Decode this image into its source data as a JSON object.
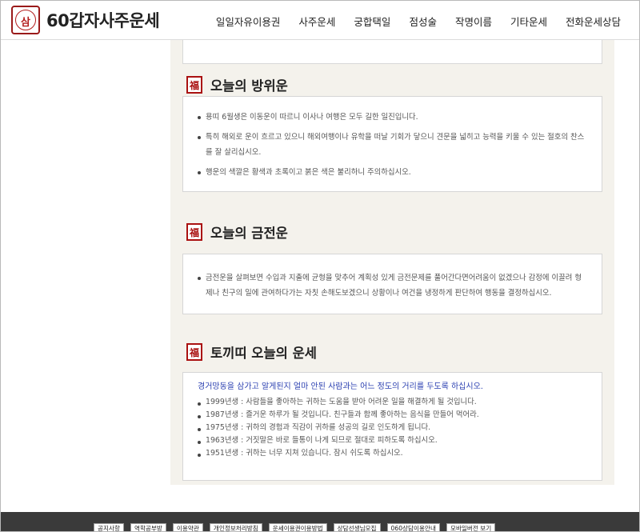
{
  "brand": {
    "name": "60갑자사주운세"
  },
  "nav": [
    "일일자유이용권",
    "사주운세",
    "궁합택일",
    "점성술",
    "작명이름",
    "기타운세",
    "전화운세상담"
  ],
  "sections": {
    "direction": {
      "title": "오늘의 방위운",
      "items": [
        "용띠 6월생은 이동운이 따르니 이사나 여행은 모두 길한 일진입니다.",
        "특히 해외로 운이 흐르고 있으니 해외여행이나 유학을 떠날 기회가 닿으니 견문을 넓히고 능력을 키울 수 있는 절호의 찬스를 잘 살리십시오.",
        "행운의 색깔은 황색과 초록이고 붉은 색은 불리하니 주의하십시오."
      ]
    },
    "money": {
      "title": "오늘의 금전운",
      "items": [
        "금전운을 살펴보면 수입과 지출에 균형을 맞추어 계획성 있게 금전문제를 풀어간다면어려움이 없겠으나 감정에 이끌려 형제나 친구의 일에 관여하다가는 자칫 손해도보겠으니 상황이나 여건을 냉정하게 판단하여 행동을 결정하십시오."
      ]
    },
    "rabbit": {
      "title": "토끼띠 오늘의 운세",
      "intro": "경거망동을 삼가고 알게된지 얼마 안된 사람과는 어느 정도의 거리를 두도록 하십시오.",
      "items": [
        "1999년생 : 사람들을 좋아하는 귀하는 도움을 받아 어려운 일을 해결하게 될 것입니다.",
        "1987년생 : 즐거운 하루가 될 것입니다. 친구들과 함께 좋아하는 음식을 만들어 먹어라.",
        "1975년생 : 귀하의 경험과 직감이 귀하를 성공의 길로 인도하게 됩니다.",
        "1963년생 : 거짓말은 바로 들통이 나게 되므로 절대로 피하도록 하십시오.",
        "1951년생 : 귀하는 너무 지쳐 있습니다. 잠시 쉬도록 하십시오."
      ]
    }
  },
  "footer": [
    "공지사항",
    "역학공부방",
    "이용약관",
    "개인정보처리방침",
    "운세이용권이용방법",
    "상담선생님모집",
    "060상담이용안내",
    "모바일버전 보기"
  ]
}
